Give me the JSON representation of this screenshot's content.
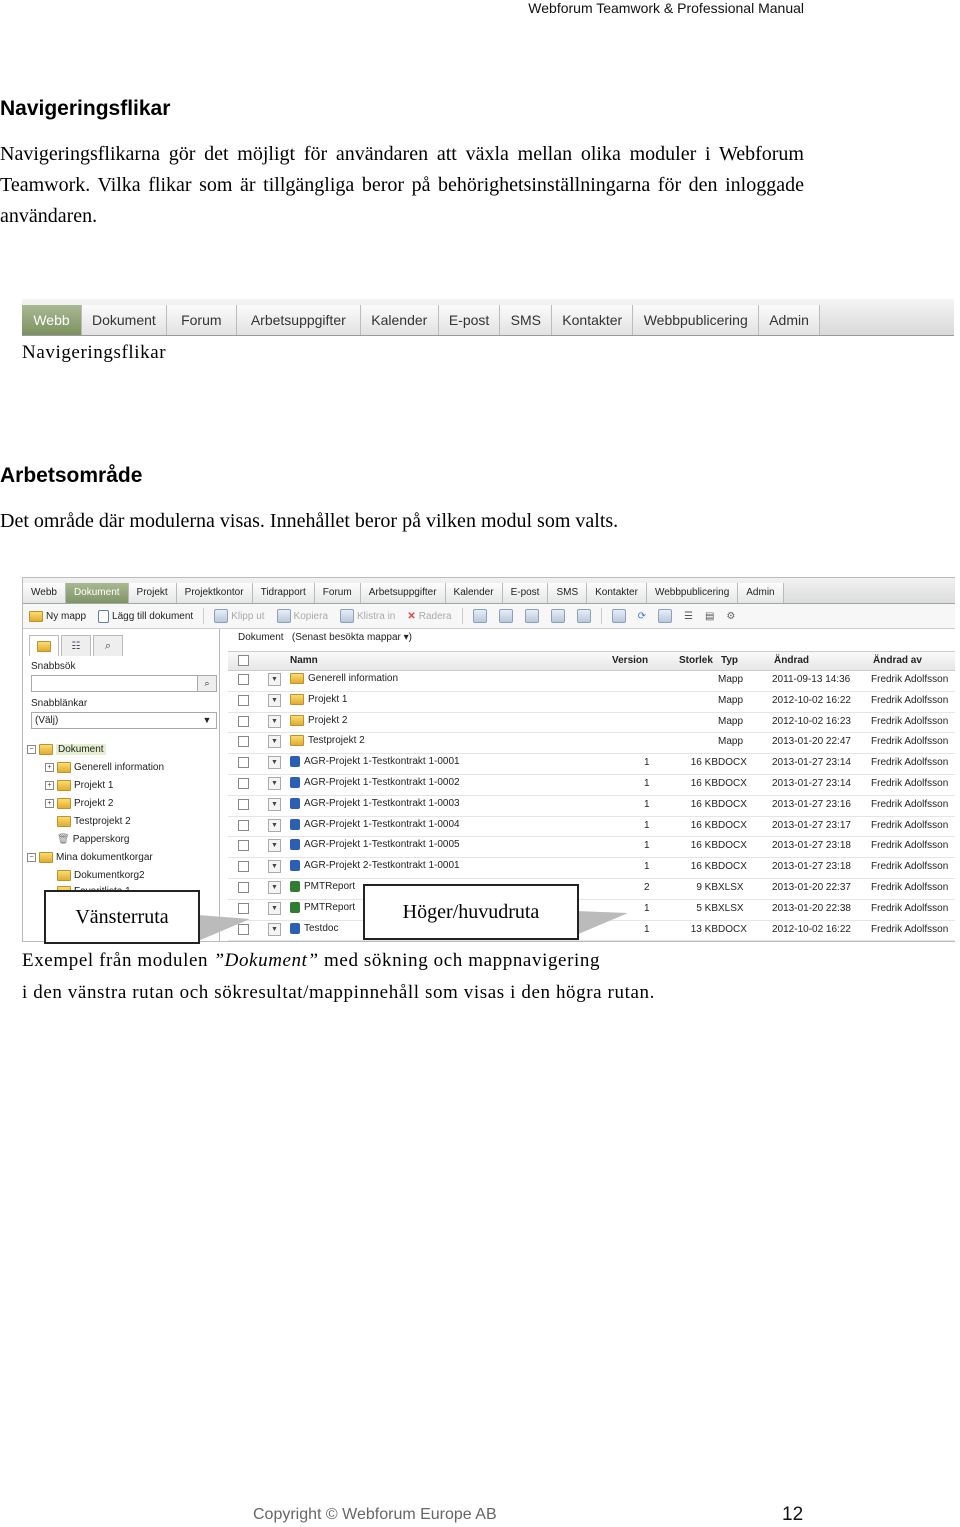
{
  "header": {
    "running_title": "Webforum Teamwork & Professional Manual"
  },
  "section1": {
    "heading": "Navigeringsflikar",
    "paragraph": "Navigeringsflikarna gör det möjligt för användaren att växla mellan olika moduler i Webforum Teamwork. Vilka flikar som är tillgängliga beror på behörighetsinställningarna för den inloggade användaren.",
    "nav_tabs": [
      "Webb",
      "Dokument",
      "Forum",
      "Arbetsuppgifter",
      "Kalender",
      "E-post",
      "SMS",
      "Kontakter",
      "Webbpublicering",
      "Admin"
    ],
    "figure_caption": "Navigeringsflikar"
  },
  "section2": {
    "heading": "Arbetsområde",
    "paragraph": "Det område där modulerna visas. Innehållet beror på vilken modul som valts."
  },
  "app": {
    "tabs": [
      "Webb",
      "Dokument",
      "Projekt",
      "Projektkontor",
      "Tidrapport",
      "Forum",
      "Arbetsuppgifter",
      "Kalender",
      "E-post",
      "SMS",
      "Kontakter",
      "Webbpublicering",
      "Admin"
    ],
    "active_tab": "Dokument",
    "toolbar": {
      "new_folder": "Ny mapp",
      "add_document": "Lägg till dokument",
      "cut": "Klipp ut",
      "copy": "Kopiera",
      "paste": "Klistra in",
      "delete": "Radera"
    },
    "left": {
      "quick_search_label": "Snabbsök",
      "quick_links_label": "Snabblänkar",
      "quick_links_value": "(Välj)",
      "tree": [
        "Dokument",
        "Generell information",
        "Projekt 1",
        "Projekt 2",
        "Testprojekt 2",
        "Papperskorg",
        "Mina dokumentkorgar",
        "Dokumentkorg2",
        "Favoritlista 1"
      ]
    },
    "right": {
      "title": "Dokument",
      "recent_dropdown": "(Senast besökta mappar ▾)",
      "columns": [
        "Namn",
        "Version",
        "Storlek",
        "Typ",
        "Ändrad",
        "Ändrad av"
      ],
      "rows": [
        {
          "name": "Generell information",
          "version": "",
          "size": "",
          "type": "Mapp",
          "modified": "2011-09-13 14:36",
          "by": "Fredrik Adolfsson",
          "folder": true
        },
        {
          "name": "Projekt 1",
          "version": "",
          "size": "",
          "type": "Mapp",
          "modified": "2012-10-02 16:22",
          "by": "Fredrik Adolfsson",
          "folder": true
        },
        {
          "name": "Projekt 2",
          "version": "",
          "size": "",
          "type": "Mapp",
          "modified": "2012-10-02 16:23",
          "by": "Fredrik Adolfsson",
          "folder": true
        },
        {
          "name": "Testprojekt 2",
          "version": "",
          "size": "",
          "type": "Mapp",
          "modified": "2013-01-20 22:47",
          "by": "Fredrik Adolfsson",
          "folder": true
        },
        {
          "name": "AGR-Projekt 1-Testkontrakt 1-0001",
          "version": "1",
          "size": "16 KB",
          "type": "DOCX",
          "modified": "2013-01-27 23:14",
          "by": "Fredrik Adolfsson",
          "folder": false
        },
        {
          "name": "AGR-Projekt 1-Testkontrakt 1-0002",
          "version": "1",
          "size": "16 KB",
          "type": "DOCX",
          "modified": "2013-01-27 23:14",
          "by": "Fredrik Adolfsson",
          "folder": false
        },
        {
          "name": "AGR-Projekt 1-Testkontrakt 1-0003",
          "version": "1",
          "size": "16 KB",
          "type": "DOCX",
          "modified": "2013-01-27 23:16",
          "by": "Fredrik Adolfsson",
          "folder": false
        },
        {
          "name": "AGR-Projekt 1-Testkontrakt 1-0004",
          "version": "1",
          "size": "16 KB",
          "type": "DOCX",
          "modified": "2013-01-27 23:17",
          "by": "Fredrik Adolfsson",
          "folder": false
        },
        {
          "name": "AGR-Projekt 1-Testkontrakt 1-0005",
          "version": "1",
          "size": "16 KB",
          "type": "DOCX",
          "modified": "2013-01-27 23:18",
          "by": "Fredrik Adolfsson",
          "folder": false
        },
        {
          "name": "AGR-Projekt 2-Testkontrakt 1-0001",
          "version": "1",
          "size": "16 KB",
          "type": "DOCX",
          "modified": "2013-01-27 23:18",
          "by": "Fredrik Adolfsson",
          "folder": false
        },
        {
          "name": "PMTReport",
          "version": "2",
          "size": "9 KB",
          "type": "XLSX",
          "modified": "2013-01-20 22:37",
          "by": "Fredrik Adolfsson",
          "folder": false
        },
        {
          "name": "PMTReport",
          "version": "1",
          "size": "5 KB",
          "type": "XLSX",
          "modified": "2013-01-20 22:38",
          "by": "Fredrik Adolfsson",
          "folder": false
        },
        {
          "name": "Testdoc",
          "version": "1",
          "size": "13 KB",
          "type": "DOCX",
          "modified": "2012-10-02 16:22",
          "by": "Fredrik Adolfsson",
          "folder": false
        }
      ]
    },
    "callout_left": "Vänsterruta",
    "callout_right": "Höger/huvudruta"
  },
  "figure2_caption": {
    "prefix": "Exempel från modulen ",
    "italic": "”Dokument”",
    "suffix": " med sökning och mappnavigering",
    "line2": "i den vänstra rutan och sökresultat/mappinnehåll som visas i den högra rutan."
  },
  "footer": {
    "copyright": "Copyright © Webforum Europe AB",
    "page_number": "12"
  }
}
